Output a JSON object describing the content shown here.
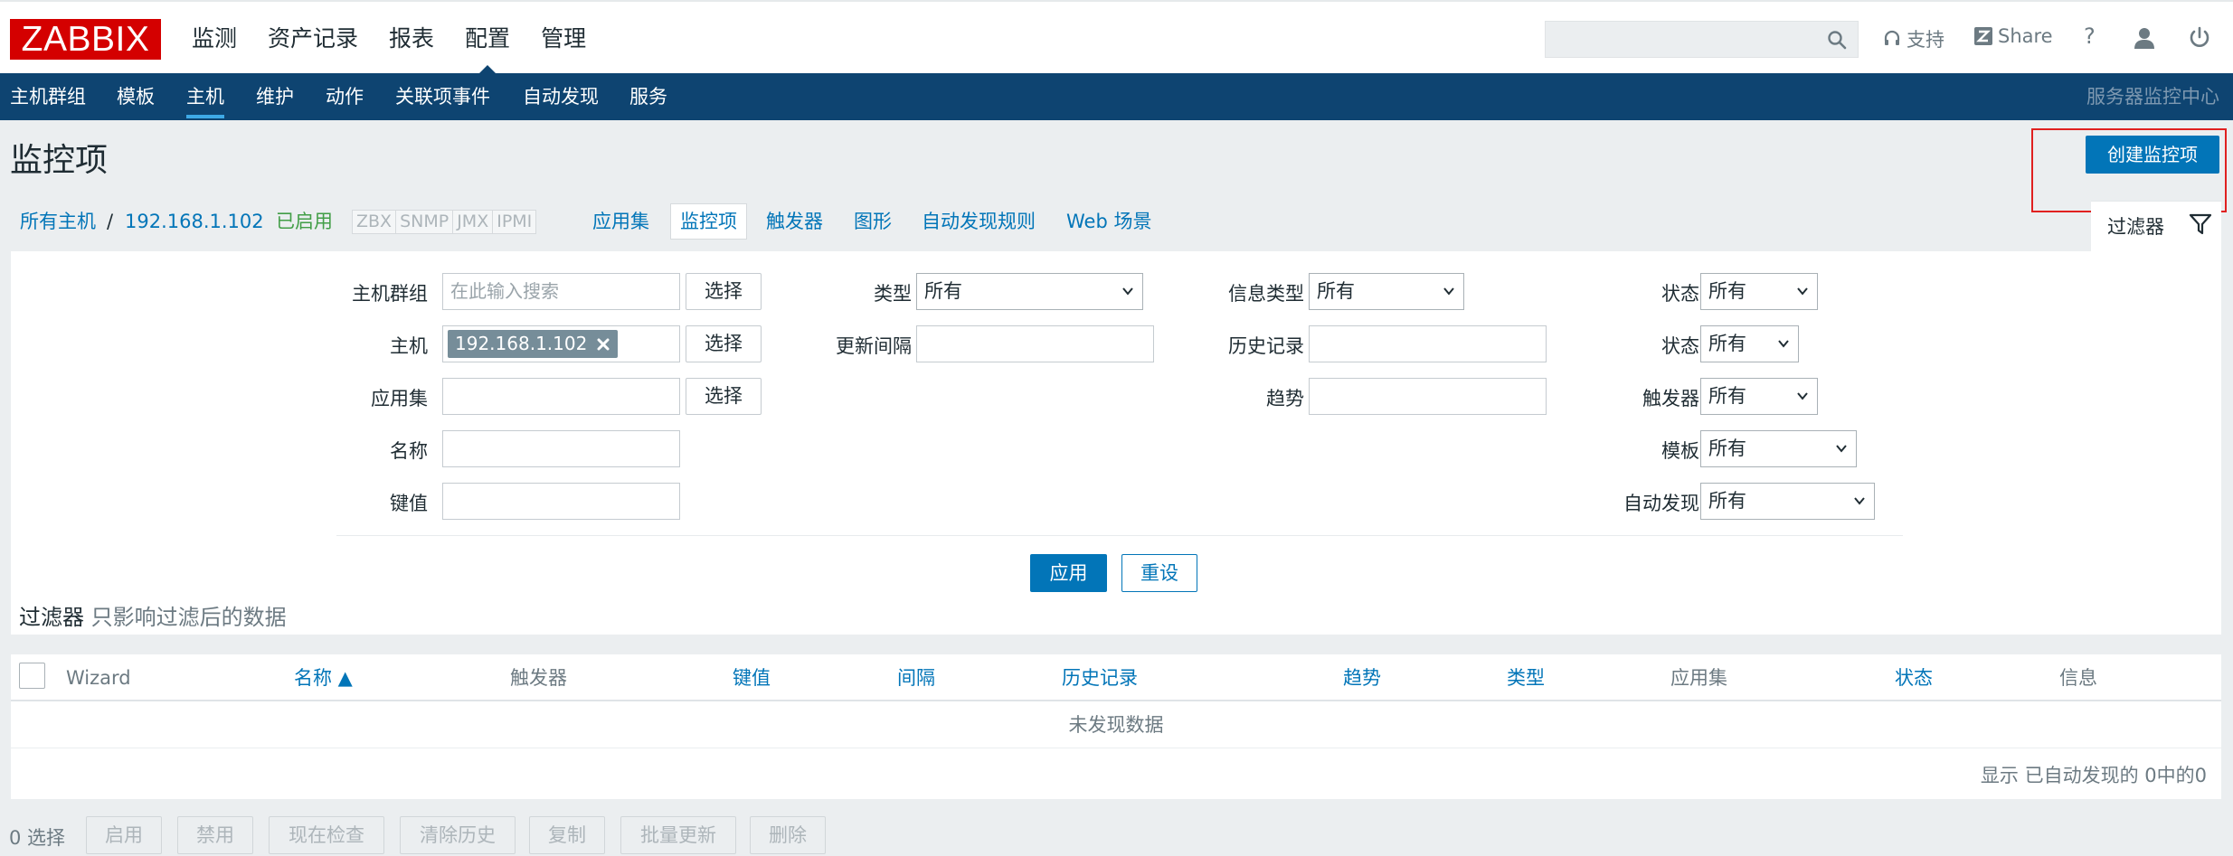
{
  "logo": "ZABBIX",
  "top_menu": [
    "监测",
    "资产记录",
    "报表",
    "配置",
    "管理"
  ],
  "top_menu_active": "配置",
  "header": {
    "support": "支持",
    "share": "Share",
    "help": "?"
  },
  "sub_menu": [
    "主机群组",
    "模板",
    "主机",
    "维护",
    "动作",
    "关联项事件",
    "自动发现",
    "服务"
  ],
  "sub_menu_right": "服务器监控中心",
  "page_title": "监控项",
  "create_button": "创建监控项",
  "breadcrumb": {
    "all_hosts": "所有主机",
    "separator": "/",
    "host": "192.168.1.102",
    "status": "已启用",
    "interfaces": [
      "ZBX",
      "SNMP",
      "JMX",
      "IPMI"
    ],
    "tabs": [
      "应用集",
      "监控项",
      "触发器",
      "图形",
      "自动发现规则",
      "Web 场景"
    ]
  },
  "filter_tab": "过滤器",
  "filter": {
    "host_group_label": "主机群组",
    "host_group_placeholder": "在此输入搜索",
    "select_label": "选择",
    "host_label": "主机",
    "host_chip": "192.168.1.102",
    "application_label": "应用集",
    "name_label": "名称",
    "key_label": "键值",
    "type_label": "类型",
    "type_value": "所有",
    "interval_label": "更新间隔",
    "info_type_label": "信息类型",
    "info_type_value": "所有",
    "history_label": "历史记录",
    "trends_label": "趋势",
    "state_label": "状态",
    "state_value": "所有",
    "status_label": "状态",
    "status_value": "所有",
    "triggers_label": "触发器",
    "triggers_value": "所有",
    "template_label": "模板",
    "template_value": "所有",
    "discovery_label": "自动发现",
    "discovery_value": "所有",
    "apply": "应用",
    "reset": "重设",
    "note_title": "过滤器",
    "note_text": "只影响过滤后的数据"
  },
  "table": {
    "columns": [
      "Wizard",
      "名称 ▲",
      "触发器",
      "键值",
      "间隔",
      "历史记录",
      "趋势",
      "类型",
      "应用集",
      "状态",
      "信息"
    ],
    "empty": "未发现数据",
    "paging": "显示 已自动发现的 0中的0"
  },
  "bottom": {
    "selected": "0 选择",
    "actions": [
      "启用",
      "禁用",
      "现在检查",
      "清除历史",
      "复制",
      "批量更新",
      "删除"
    ]
  },
  "colors": {
    "brand_red": "#d40000",
    "nav_blue": "#0e4471",
    "link_blue": "#0275b8",
    "enabled_green": "#429e47"
  }
}
